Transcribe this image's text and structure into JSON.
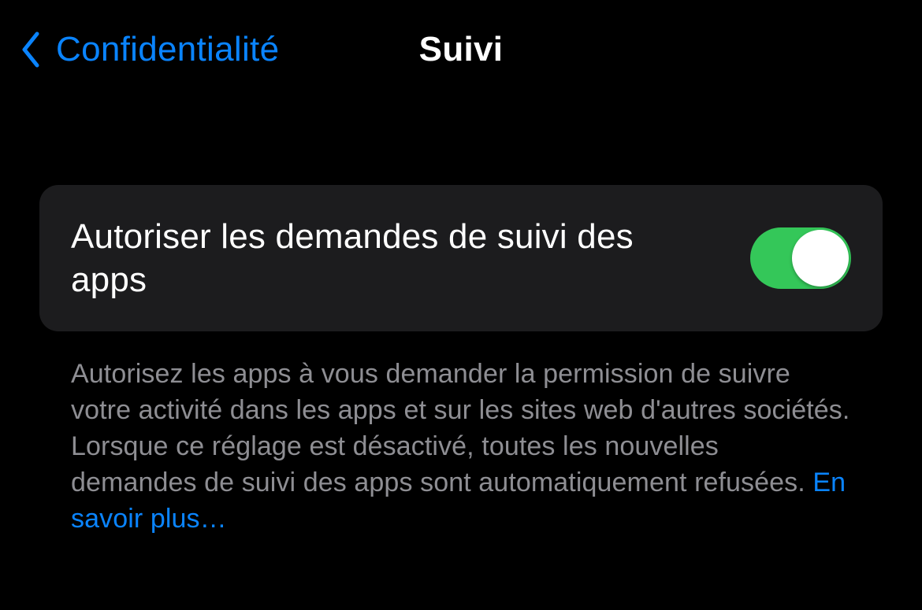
{
  "nav": {
    "back_label": "Confidentialité",
    "title": "Suivi"
  },
  "setting": {
    "label": "Autoriser les demandes de suivi des apps",
    "enabled": true
  },
  "description": {
    "text": "Autorisez les apps à vous demander la permission de suivre votre activité dans les apps et sur les sites web d'autres sociétés. Lorsque ce réglage est désactivé, toutes les nouvelles demandes de suivi des apps sont automatiquement refusées. ",
    "link": "En savoir plus…"
  }
}
